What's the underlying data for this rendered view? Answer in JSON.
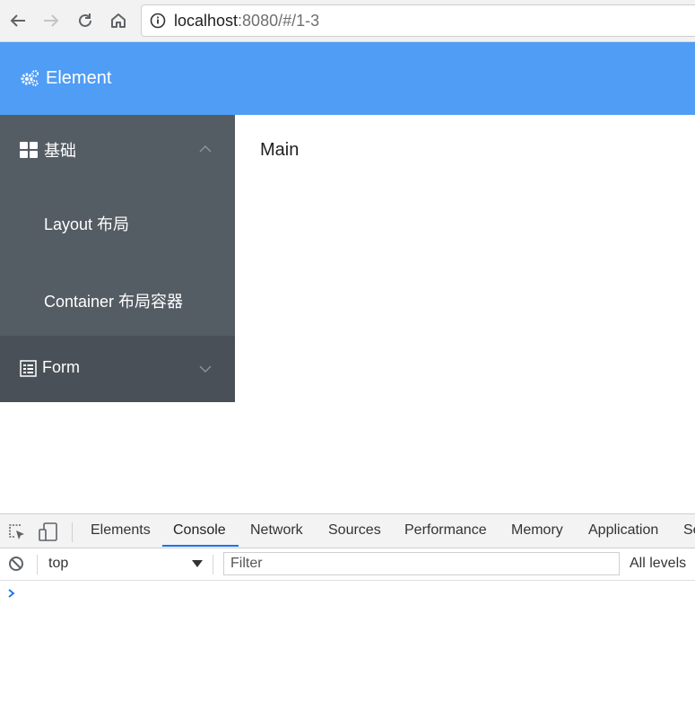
{
  "browser": {
    "url_host": "localhost",
    "url_rest": ":8080/#/1-3",
    "icons": [
      "back-icon",
      "forward-icon",
      "reload-icon",
      "home-icon",
      "info-icon"
    ]
  },
  "header": {
    "title": "Element",
    "icon": "gears-icon",
    "color": "#4f9df5"
  },
  "sidebar": {
    "background": "#545c64",
    "submenu": {
      "label": "基础",
      "icon": "grid-icon",
      "expanded": true,
      "items": [
        {
          "label": "Layout 布局"
        },
        {
          "label": "Container 布局容器"
        }
      ]
    },
    "form": {
      "label": "Form",
      "icon": "form-icon",
      "expanded": false
    }
  },
  "main": {
    "text": "Main"
  },
  "devtools": {
    "tabs": [
      "Elements",
      "Console",
      "Network",
      "Sources",
      "Performance",
      "Memory",
      "Application",
      "Se"
    ],
    "active_tab": "Console",
    "context": "top",
    "filter_placeholder": "Filter",
    "levels": "All levels"
  }
}
